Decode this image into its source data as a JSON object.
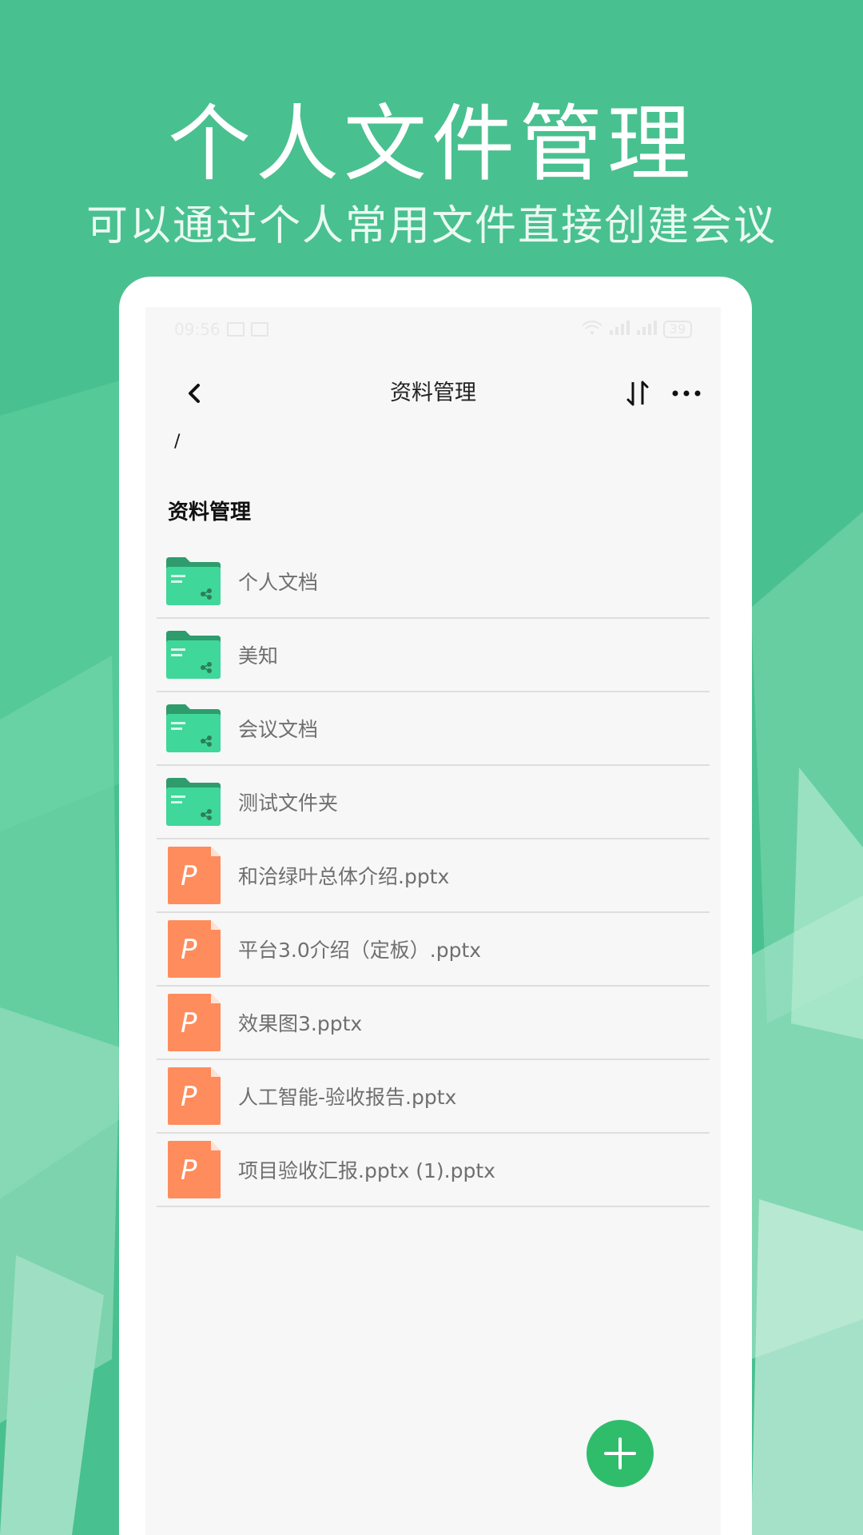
{
  "promo": {
    "headline": "个人文件管理",
    "subline": "可以通过个人常用文件直接创建会议"
  },
  "status_bar": {
    "time": "09:56",
    "right_text": "",
    "battery": "39"
  },
  "navbar": {
    "title": "资料管理"
  },
  "breadcrumb": "/",
  "section_title": "资料管理",
  "items": [
    {
      "type": "folder",
      "name": "个人文档"
    },
    {
      "type": "folder",
      "name": "美知"
    },
    {
      "type": "folder",
      "name": "会议文档"
    },
    {
      "type": "folder",
      "name": "测试文件夹"
    },
    {
      "type": "pptx",
      "name": "和洽绿叶总体介绍.pptx"
    },
    {
      "type": "pptx",
      "name": "平台3.0介绍（定板）.pptx"
    },
    {
      "type": "pptx",
      "name": "效果图3.pptx"
    },
    {
      "type": "pptx",
      "name": "人工智能-验收报告.pptx"
    },
    {
      "type": "pptx",
      "name": "项目验收汇报.pptx (1).pptx"
    }
  ],
  "icons": {
    "back": "back-chevron-icon",
    "sort": "sort-arrows-icon",
    "more": "more-dots-icon",
    "folder": "shared-folder-icon",
    "pptx": "ppt-file-icon",
    "fab": "plus-icon"
  },
  "colors": {
    "brand_green": "#49c08f",
    "folder_green": "#3fd79a",
    "ppt_orange": "#ff8c5c",
    "fab_green": "#2fbd6c"
  }
}
